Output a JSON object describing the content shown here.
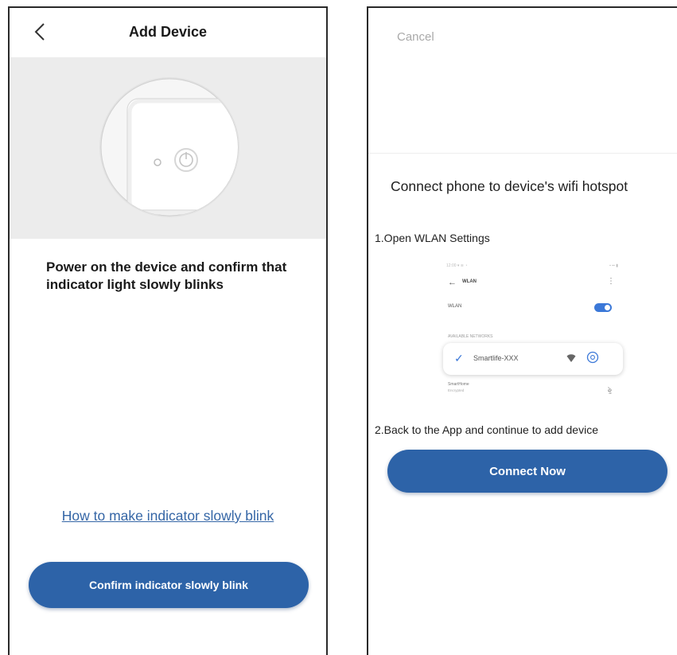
{
  "left_screen": {
    "header": {
      "title": "Add Device"
    },
    "instruction": "Power on the device and confirm that indicator light slowly blinks",
    "help_link": "How to make indicator slowly blink",
    "confirm_button": "Confirm indicator slowly blink"
  },
  "right_screen": {
    "cancel": "Cancel",
    "title": "Connect phone to device's wifi hotspot",
    "step_1": "1.Open WLAN Settings",
    "wlan_mockup": {
      "status_left": "12:00 ▾ ≋ ◔",
      "status_right": "▪ ▪▪ ▮",
      "nav_title": "WLAN",
      "row_label": "WLAN",
      "wlan_enabled": true,
      "section_label": "AVAILABLE NETWORKS",
      "network_name": "Smartlife-XXX",
      "other_network": "SmartHome",
      "other_network_sub": "Encrypted"
    },
    "step_2": "2.Back to the App and continue to add device",
    "connect_button": "Connect Now"
  },
  "colors": {
    "primary_button": "#2d63a8",
    "link": "#3566a6",
    "hero_background": "#ececec",
    "cancel_text": "#a9a9a9",
    "toggle_on": "#3b78d8"
  },
  "icons": [
    "back-chevron-icon",
    "device-switch-icon",
    "power-icon",
    "checkmark-icon",
    "wifi-icon",
    "info-icon",
    "lock-icon"
  ]
}
